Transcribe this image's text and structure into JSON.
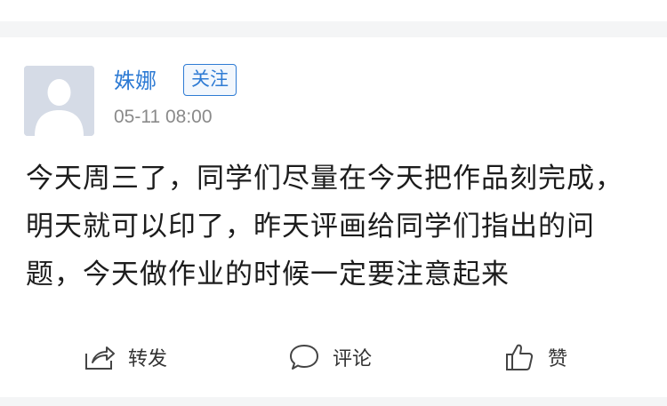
{
  "post": {
    "author": "姝娜",
    "follow_label": "关注",
    "timestamp": "05-11 08:00",
    "content": "今天周三了，同学们尽量在今天把作品刻完成，明天就可以印了，昨天评画给同学们指出的问题，今天做作业的时候一定要注意起来"
  },
  "actions": {
    "share": {
      "label": "转发",
      "icon": "share-icon"
    },
    "comment": {
      "label": "评论",
      "icon": "comment-icon"
    },
    "like": {
      "label": "赞",
      "icon": "thumbs-up-icon"
    }
  },
  "colors": {
    "accent": "#2e7bd4",
    "avatar_bg": "#d5dbe6",
    "separator": "#f4f5f6"
  }
}
